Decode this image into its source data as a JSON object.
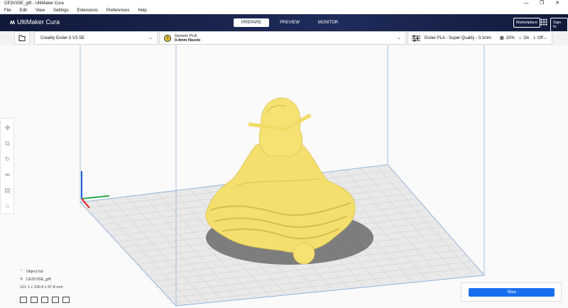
{
  "window": {
    "title": "CE3V3SE_gift - UltiMaker Cura",
    "controls": [
      "—",
      "❐",
      "✕"
    ]
  },
  "menu": [
    "File",
    "Edit",
    "View",
    "Settings",
    "Extensions",
    "Preferences",
    "Help"
  ],
  "header": {
    "logo": "UltiMaker Cura",
    "stages": [
      "PREPARE",
      "PREVIEW",
      "MONITOR"
    ],
    "active_stage": "PREPARE",
    "marketplace": "Marketplace",
    "signin": "Sign In"
  },
  "printer": {
    "name": "Creality Ender-3 V3 SE"
  },
  "material": {
    "slot": "1",
    "name": "Generic PLA",
    "nozzle": "0.4mm Nozzle",
    "color": "#e0c233"
  },
  "quality": {
    "profile": "Ender PLA - Super Quality - 0.1mm",
    "infill": "10%",
    "support": "On",
    "adhesion": "Off"
  },
  "objects": {
    "header": "Object list",
    "name": "CE3V3SE_gift",
    "dimensions": "121.1 x 100.9 x 97.8 mm"
  },
  "slice": {
    "label": "Slice"
  },
  "colors": {
    "model": "#f7e37a",
    "buildplate": "#ececec",
    "accent": "#196ef0",
    "header": "#19233b"
  }
}
